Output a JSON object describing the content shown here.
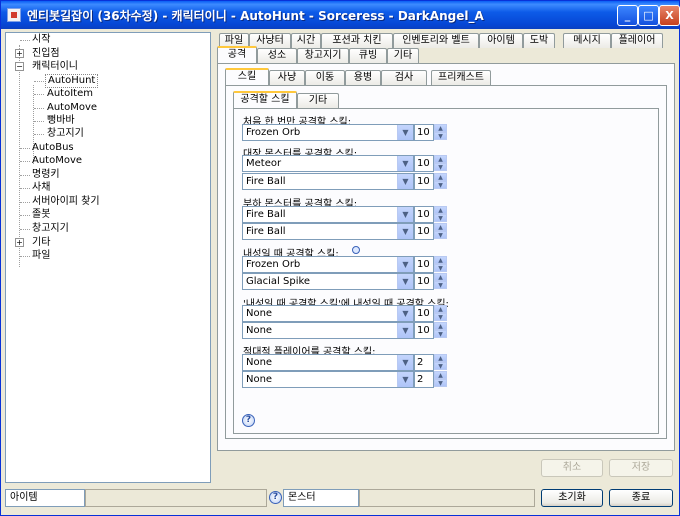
{
  "window": {
    "title": "엔티봇길잡이 (36차수정) - 캐릭터이니 - AutoHunt - Sorceress - DarkAngel_A",
    "minimize": "_",
    "maximize": "□",
    "close": "X"
  },
  "tree": {
    "items": [
      {
        "label": "시작"
      },
      {
        "label": "진입점",
        "expander": "+"
      },
      {
        "label": "캐릭터이니",
        "expander": "−"
      },
      {
        "label": "AutoHunt"
      },
      {
        "label": "AutoItem"
      },
      {
        "label": "AutoMove"
      },
      {
        "label": "뻥바바"
      },
      {
        "label": "창고지기"
      },
      {
        "label": "AutoBus"
      },
      {
        "label": "AutoMove"
      },
      {
        "label": "명령키"
      },
      {
        "label": "사채"
      },
      {
        "label": "서버아이피 찾기"
      },
      {
        "label": "졸봇"
      },
      {
        "label": "창고지기"
      },
      {
        "label": "기타",
        "expander": "+"
      },
      {
        "label": "파일"
      }
    ]
  },
  "top_tabs": {
    "row1": [
      "파일",
      "사냥터",
      "시간",
      "포션과 치킨",
      "인벤토리와 벨트",
      "아이템",
      "도박",
      "메시지",
      "플레이어"
    ],
    "row2": [
      "공격",
      "성소",
      "창고지기",
      "큐빙",
      "기타"
    ],
    "active": "공격"
  },
  "sub_tabs": {
    "items": [
      "스킬",
      "사냥",
      "이동",
      "용병",
      "검사",
      "프리캐스트"
    ],
    "active": "스킬"
  },
  "inner_tabs": {
    "items": [
      "공격할 스킬",
      "기타"
    ],
    "active": "공격할 스킬"
  },
  "skills": {
    "sections": [
      {
        "label": "처음 한 번만 공격할 스킬:",
        "rows": [
          {
            "skill": "Frozen Orb",
            "count": "10"
          }
        ]
      },
      {
        "label": "대장 몬스터를 공격할 스킬:",
        "rows": [
          {
            "skill": "Meteor",
            "count": "10"
          },
          {
            "skill": "Fire Ball",
            "count": "10"
          }
        ]
      },
      {
        "label": "부하 몬스터를 공격할 스킬:",
        "rows": [
          {
            "skill": "Fire Ball",
            "count": "10"
          },
          {
            "skill": "Fire Ball",
            "count": "10"
          }
        ]
      },
      {
        "label": "내성일 때 공격할 스킬:",
        "rows": [
          {
            "skill": "Frozen Orb",
            "count": "10"
          },
          {
            "skill": "Glacial Spike",
            "count": "10"
          }
        ]
      },
      {
        "label": "'내성일 때 공격할 스킬'에 내성일 때 공격할 스킬:",
        "rows": [
          {
            "skill": "None",
            "count": "10"
          },
          {
            "skill": "None",
            "count": "10"
          }
        ]
      },
      {
        "label": "적대적 플레이어를 공격할 스킬:",
        "rows": [
          {
            "skill": "None",
            "count": "2"
          },
          {
            "skill": "None",
            "count": "2"
          }
        ]
      }
    ],
    "help": "?"
  },
  "actions": {
    "cancel": "취소",
    "save": "저장"
  },
  "statusbar": {
    "item_field": "아이템",
    "help": "?",
    "monster_field": "몬스터",
    "reset": "초기화",
    "quit": "종료"
  }
}
